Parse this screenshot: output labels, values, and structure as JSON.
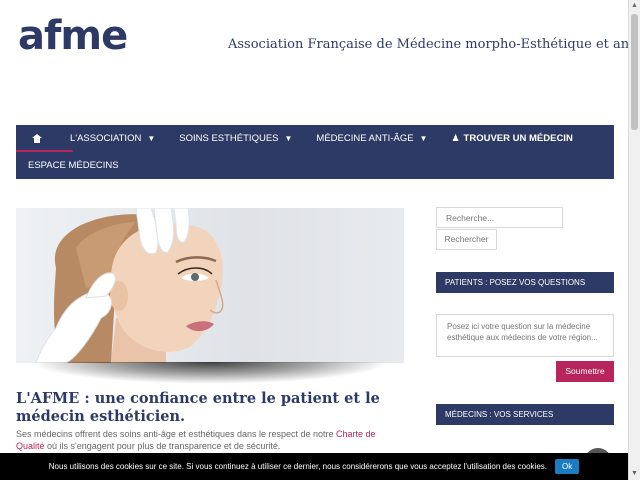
{
  "header": {
    "logo": "afme",
    "tagline": "Association Française de Médecine morpho-Esthétique et anti-âge"
  },
  "nav": {
    "home_icon": "home-icon",
    "items": [
      {
        "label": "L'ASSOCIATION",
        "icon": "chevron-down-icon"
      },
      {
        "label": "SOINS ESTHÉTIQUES",
        "icon": "chevron-down-icon"
      },
      {
        "label": "MÉDECINE ANTI-ÂGE",
        "icon": "chevron-down-icon"
      },
      {
        "label": "TROUVER UN MÉDECIN",
        "icon": "user-md-icon"
      },
      {
        "label": "ESPACE MÉDECINS"
      }
    ]
  },
  "main": {
    "hero_alt": "face-treatment-image",
    "title": "L'AFME : une confiance entre le patient et le médecin esthéticien.",
    "text_before_link": "Ses médecins offrent des soins anti-âge et esthétiques dans le respect de notre ",
    "link": "Charte de Qualité",
    "text_after_link": " où ils s'engagent pour plus de transparence et de sécurité."
  },
  "sidebar": {
    "search_placeholder": "Recherche...",
    "search_button": "Rechercher",
    "widget1_title": "PATIENTS : POSEZ VOS QUESTIONS",
    "question_placeholder": "Posez ici votre question sur la médecine esthétique aux médecins de votre région...",
    "submit_button": "Soumettre",
    "widget2_title": "MÉDECINS : VOS SERVICES"
  },
  "cookie": {
    "message": "Nous utilisons des cookies sur ce site. Si vous continuez à utiliser ce dernier, nous considérerons que vous acceptez l'utilisation des cookies.",
    "button": "Ok"
  },
  "colors": {
    "brand": "#2d3a65",
    "accent": "#b8245c",
    "cookie_button": "#1a7cc1"
  }
}
